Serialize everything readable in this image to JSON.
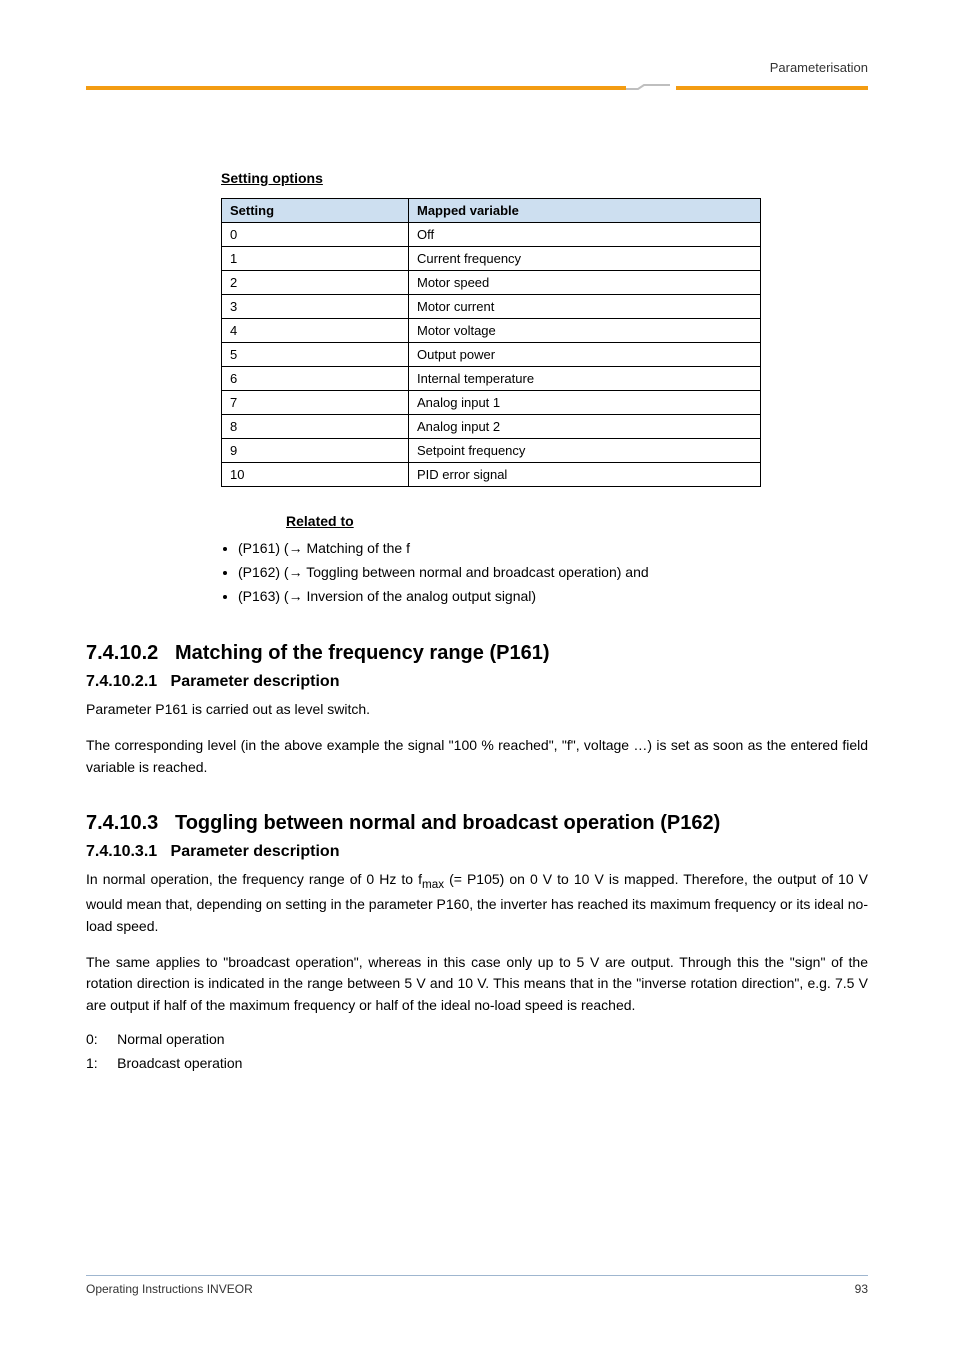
{
  "header": {
    "right_text": "Parameterisation"
  },
  "setting_options_heading": "Setting options",
  "table": {
    "head_left": "Setting",
    "head_right": "Mapped variable",
    "rows": [
      {
        "val": "0",
        "meaning": "Off"
      },
      {
        "val": "1",
        "meaning": "Current frequency"
      },
      {
        "val": "2",
        "meaning": "Motor speed"
      },
      {
        "val": "3",
        "meaning": "Motor current"
      },
      {
        "val": "4",
        "meaning": "Motor voltage"
      },
      {
        "val": "5",
        "meaning": "Output power"
      },
      {
        "val": "6",
        "meaning": "Internal temperature"
      },
      {
        "val": "7",
        "meaning": "Analog input 1"
      },
      {
        "val": "8",
        "meaning": "Analog input 2"
      },
      {
        "val": "9",
        "meaning": "Setpoint frequency"
      },
      {
        "val": "10",
        "meaning": "PID error signal"
      }
    ]
  },
  "related_heading": "Related to",
  "bullets": [
    "(P161) (→ Matching of the f",
    "(P162) (→ Toggling between normal and broadcast operation) and",
    "(P163) (→ Inversion of the analog output signal)"
  ],
  "sec161": {
    "num": "7.4.10.2",
    "title": "Matching of the frequency range (P161)",
    "sub_num": "7.4.10.2.1",
    "sub_title": "Parameter description",
    "para1": "Parameter P161 is carried out as level switch.",
    "para2": "The corresponding level (in the above example the signal \"100 % reached\", \"f\", voltage …) is set as soon as the entered field variable is reached."
  },
  "sec162": {
    "num": "7.4.10.3",
    "title": "Toggling between normal and broadcast operation (P162)",
    "sub_num": "7.4.10.3.1",
    "sub_title": "Parameter description",
    "para1_a": "In normal operation, the frequency range of 0 Hz to f",
    "para1_b": " (= P105) on 0 V to 10 V is mapped. Therefore, the output of 10 V would mean that, depending on setting in the parameter P160, the inverter has reached its maximum frequency or its ideal no-load speed.",
    "para2": "The same applies to \"broadcast operation\", whereas in this case only up to 5 V are output. Through this the \"sign\" of the rotation direction is indicated in the range between 5 V and 10 V. This means that in the \"inverse rotation direction\", e.g. 7.5 V are output if half of the maximum frequency or half of the ideal no-load speed is reached.",
    "sub0_label": "0:",
    "sub0_text": "Normal operation",
    "sub1_label": "1:",
    "sub1_text": "Broadcast operation"
  },
  "footer": {
    "left": "Operating Instructions INVEOR",
    "right": "93"
  }
}
